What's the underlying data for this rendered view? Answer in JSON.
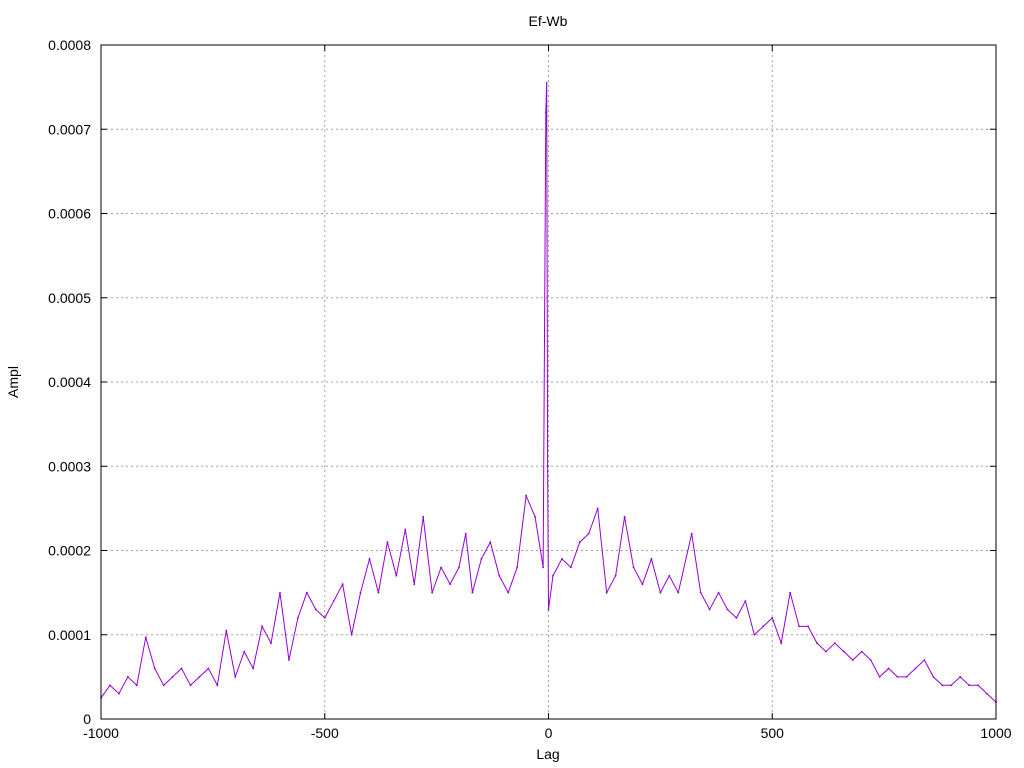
{
  "chart_data": {
    "type": "line",
    "title": "Ef-Wb",
    "xlabel": "Lag",
    "ylabel": "Ampl",
    "xlim": [
      -1000,
      1000
    ],
    "ylim": [
      0,
      0.0008
    ],
    "x_ticks": [
      "-1000",
      "-500",
      "0",
      "500",
      "1000"
    ],
    "y_ticks": [
      "0",
      "0.0001",
      "0.0002",
      "0.0003",
      "0.0004",
      "0.0005",
      "0.0006",
      "0.0007",
      "0.0008"
    ],
    "grid": true,
    "color": "#9400d3",
    "series": [
      {
        "points": [
          [
            -1000,
            2.5e-05
          ],
          [
            -980,
            4e-05
          ],
          [
            -960,
            3e-05
          ],
          [
            -940,
            5e-05
          ],
          [
            -920,
            4e-05
          ],
          [
            -900,
            9.7e-05
          ],
          [
            -880,
            6e-05
          ],
          [
            -860,
            4e-05
          ],
          [
            -840,
            5e-05
          ],
          [
            -820,
            6e-05
          ],
          [
            -800,
            4e-05
          ],
          [
            -780,
            5e-05
          ],
          [
            -760,
            6e-05
          ],
          [
            -740,
            4e-05
          ],
          [
            -720,
            0.000105
          ],
          [
            -700,
            5e-05
          ],
          [
            -680,
            8e-05
          ],
          [
            -660,
            6e-05
          ],
          [
            -640,
            0.00011
          ],
          [
            -620,
            9e-05
          ],
          [
            -600,
            0.00015
          ],
          [
            -580,
            7e-05
          ],
          [
            -560,
            0.00012
          ],
          [
            -540,
            0.00015
          ],
          [
            -520,
            0.00013
          ],
          [
            -500,
            0.00012
          ],
          [
            -480,
            0.00014
          ],
          [
            -460,
            0.00016
          ],
          [
            -440,
            0.0001
          ],
          [
            -420,
            0.00015
          ],
          [
            -400,
            0.00019
          ],
          [
            -380,
            0.00015
          ],
          [
            -360,
            0.00021
          ],
          [
            -340,
            0.00017
          ],
          [
            -320,
            0.000225
          ],
          [
            -300,
            0.00016
          ],
          [
            -280,
            0.00024
          ],
          [
            -260,
            0.00015
          ],
          [
            -240,
            0.00018
          ],
          [
            -220,
            0.00016
          ],
          [
            -200,
            0.00018
          ],
          [
            -185,
            0.00022
          ],
          [
            -170,
            0.00015
          ],
          [
            -150,
            0.00019
          ],
          [
            -130,
            0.00021
          ],
          [
            -110,
            0.00017
          ],
          [
            -90,
            0.00015
          ],
          [
            -70,
            0.00018
          ],
          [
            -50,
            0.000265
          ],
          [
            -30,
            0.00024
          ],
          [
            -12,
            0.00018
          ],
          [
            -6,
            0.00072
          ],
          [
            -4,
            0.000755
          ],
          [
            -2,
            0.0003
          ],
          [
            0,
            0.00013
          ],
          [
            10,
            0.00017
          ],
          [
            30,
            0.00019
          ],
          [
            50,
            0.00018
          ],
          [
            70,
            0.00021
          ],
          [
            90,
            0.00022
          ],
          [
            110,
            0.00025
          ],
          [
            130,
            0.00015
          ],
          [
            150,
            0.00017
          ],
          [
            170,
            0.00024
          ],
          [
            190,
            0.00018
          ],
          [
            210,
            0.00016
          ],
          [
            230,
            0.00019
          ],
          [
            250,
            0.00015
          ],
          [
            270,
            0.00017
          ],
          [
            290,
            0.00015
          ],
          [
            320,
            0.00022
          ],
          [
            340,
            0.00015
          ],
          [
            360,
            0.00013
          ],
          [
            380,
            0.00015
          ],
          [
            400,
            0.00013
          ],
          [
            420,
            0.00012
          ],
          [
            440,
            0.00014
          ],
          [
            460,
            0.0001
          ],
          [
            480,
            0.00011
          ],
          [
            500,
            0.00012
          ],
          [
            520,
            9e-05
          ],
          [
            540,
            0.00015
          ],
          [
            560,
            0.00011
          ],
          [
            580,
            0.00011
          ],
          [
            600,
            9e-05
          ],
          [
            620,
            8e-05
          ],
          [
            640,
            9e-05
          ],
          [
            660,
            8e-05
          ],
          [
            680,
            7e-05
          ],
          [
            700,
            8e-05
          ],
          [
            720,
            7e-05
          ],
          [
            740,
            5e-05
          ],
          [
            760,
            6e-05
          ],
          [
            780,
            5e-05
          ],
          [
            800,
            5e-05
          ],
          [
            820,
            6e-05
          ],
          [
            840,
            7e-05
          ],
          [
            860,
            5e-05
          ],
          [
            880,
            4e-05
          ],
          [
            900,
            4e-05
          ],
          [
            920,
            5e-05
          ],
          [
            940,
            4e-05
          ],
          [
            960,
            4e-05
          ],
          [
            980,
            3e-05
          ],
          [
            1000,
            2e-05
          ]
        ]
      }
    ]
  }
}
